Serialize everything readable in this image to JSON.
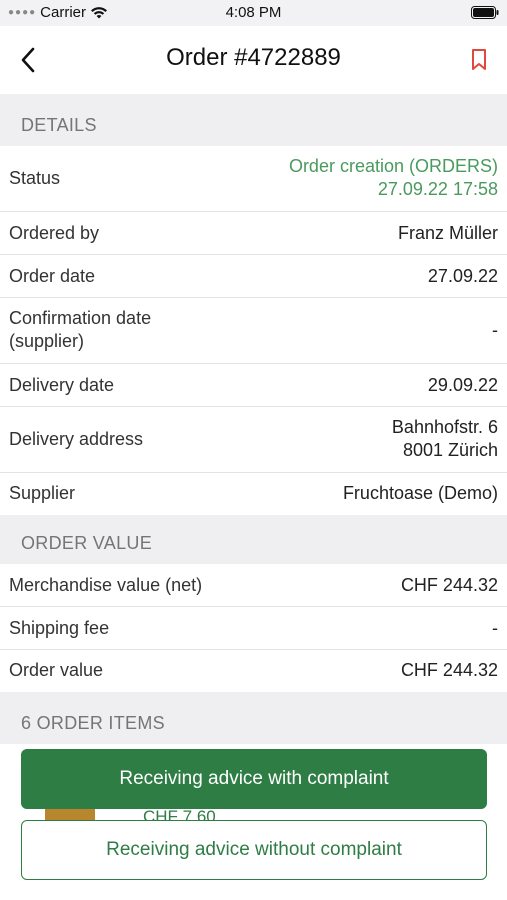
{
  "status_bar": {
    "carrier": "Carrier",
    "time": "4:08 PM"
  },
  "nav": {
    "title": "Order #4722889"
  },
  "details": {
    "header": "DETAILS",
    "rows": [
      {
        "label": "Status",
        "value_line1": "Order creation (ORDERS)",
        "value_line2": "27.09.22 17:58",
        "accent": "#4a9a5e"
      },
      {
        "label": "Ordered by",
        "value": "Franz Müller"
      },
      {
        "label": "Order date",
        "value": "27.09.22"
      },
      {
        "label_line1": "Confirmation date",
        "label_line2": "(supplier)",
        "value": "-"
      },
      {
        "label": "Delivery date",
        "value": "29.09.22"
      },
      {
        "label": "Delivery address",
        "value_line1": "Bahnhofstr. 6",
        "value_line2": "8001 Zürich"
      },
      {
        "label": "Supplier",
        "value": "Fruchtoase (Demo)"
      }
    ]
  },
  "order_value": {
    "header": "ORDER VALUE",
    "rows": [
      {
        "label": "Merchandise value (net)",
        "value": "CHF 244.32"
      },
      {
        "label": "Shipping fee",
        "value": "-"
      },
      {
        "label": "Order value",
        "value": "CHF 244.32"
      }
    ]
  },
  "items": {
    "header": "6 ORDER ITEMS",
    "partial_price": "CHF 7.60"
  },
  "actions": {
    "primary": "Receiving advice with complaint",
    "secondary": "Receiving advice without complaint"
  },
  "colors": {
    "brand_green": "#2e7d44",
    "status_green": "#4a9a5e",
    "bookmark_red": "#e0483e"
  }
}
